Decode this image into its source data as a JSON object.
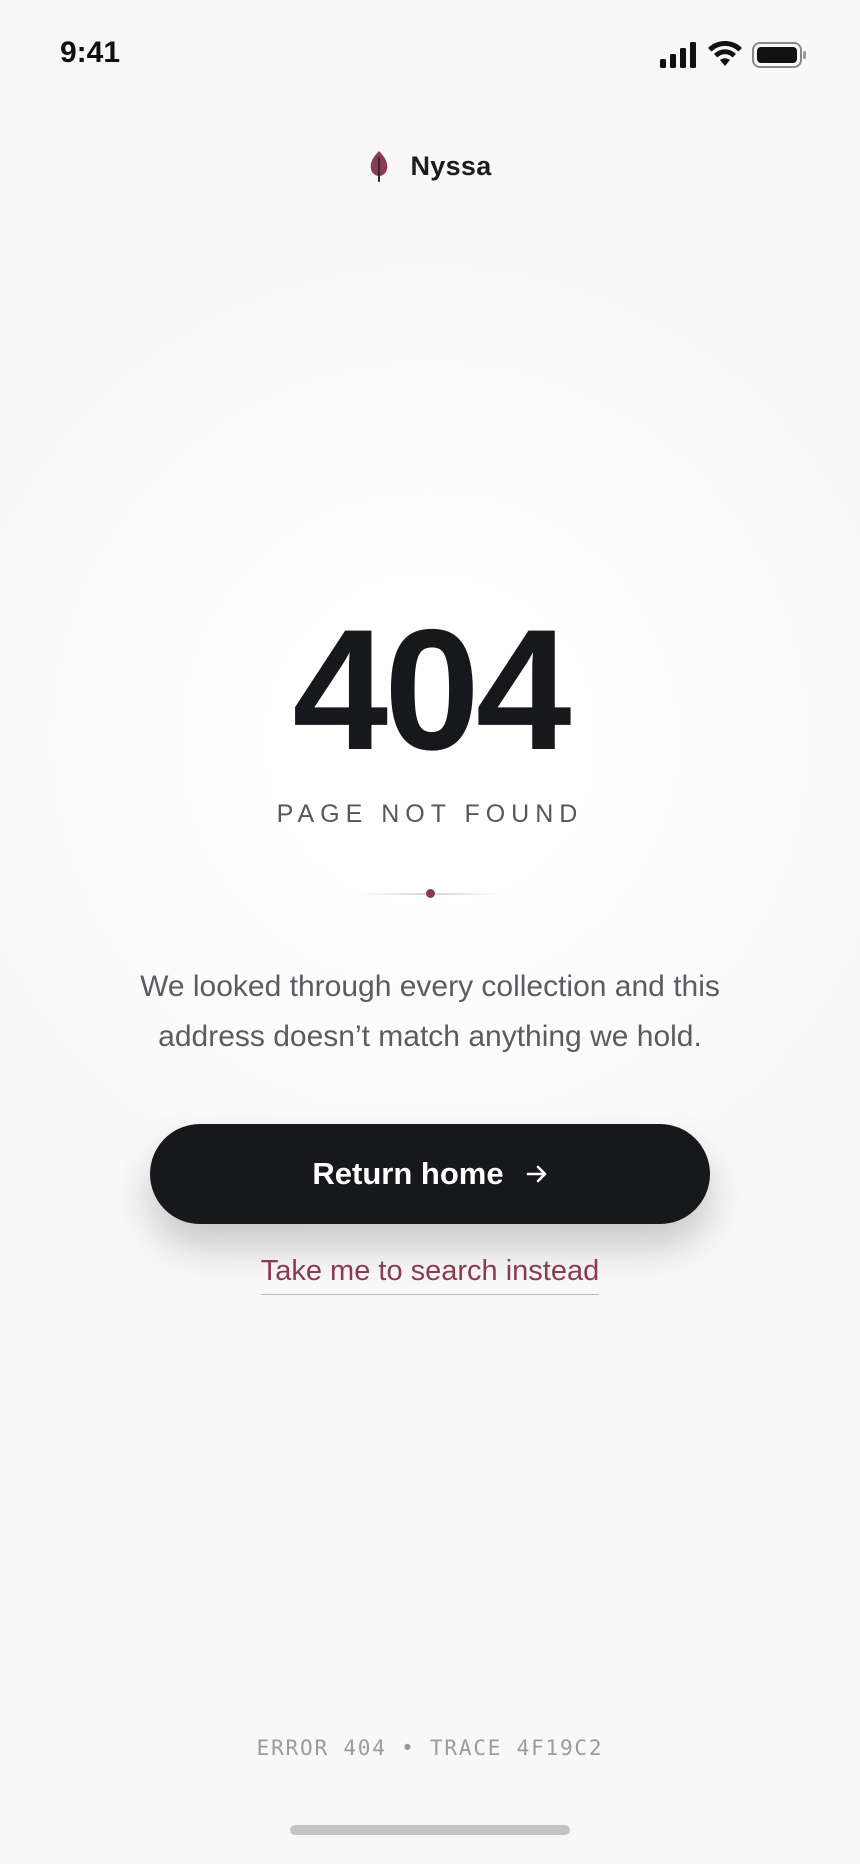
{
  "status_bar": {
    "time": "9:41",
    "icons": [
      "signal-icon",
      "wifi-icon",
      "battery-icon"
    ]
  },
  "brand": {
    "name": "Nyssa",
    "icon": "leaf-icon",
    "accent_color": "#8b3b51"
  },
  "error": {
    "code": "404",
    "subtitle": "PAGE NOT FOUND",
    "description": "We looked through every collection and this address doesn’t match anything we hold."
  },
  "actions": {
    "primary_label": "Return home",
    "primary_icon": "arrow-right-icon",
    "secondary_label": "Take me to search instead"
  },
  "footer": {
    "trace": "ERROR 404 • TRACE 4F19C2"
  },
  "colors": {
    "background": "#f8f8f8",
    "text_primary": "#17181b",
    "button_bg": "#17181b",
    "link": "#8b3b51"
  }
}
